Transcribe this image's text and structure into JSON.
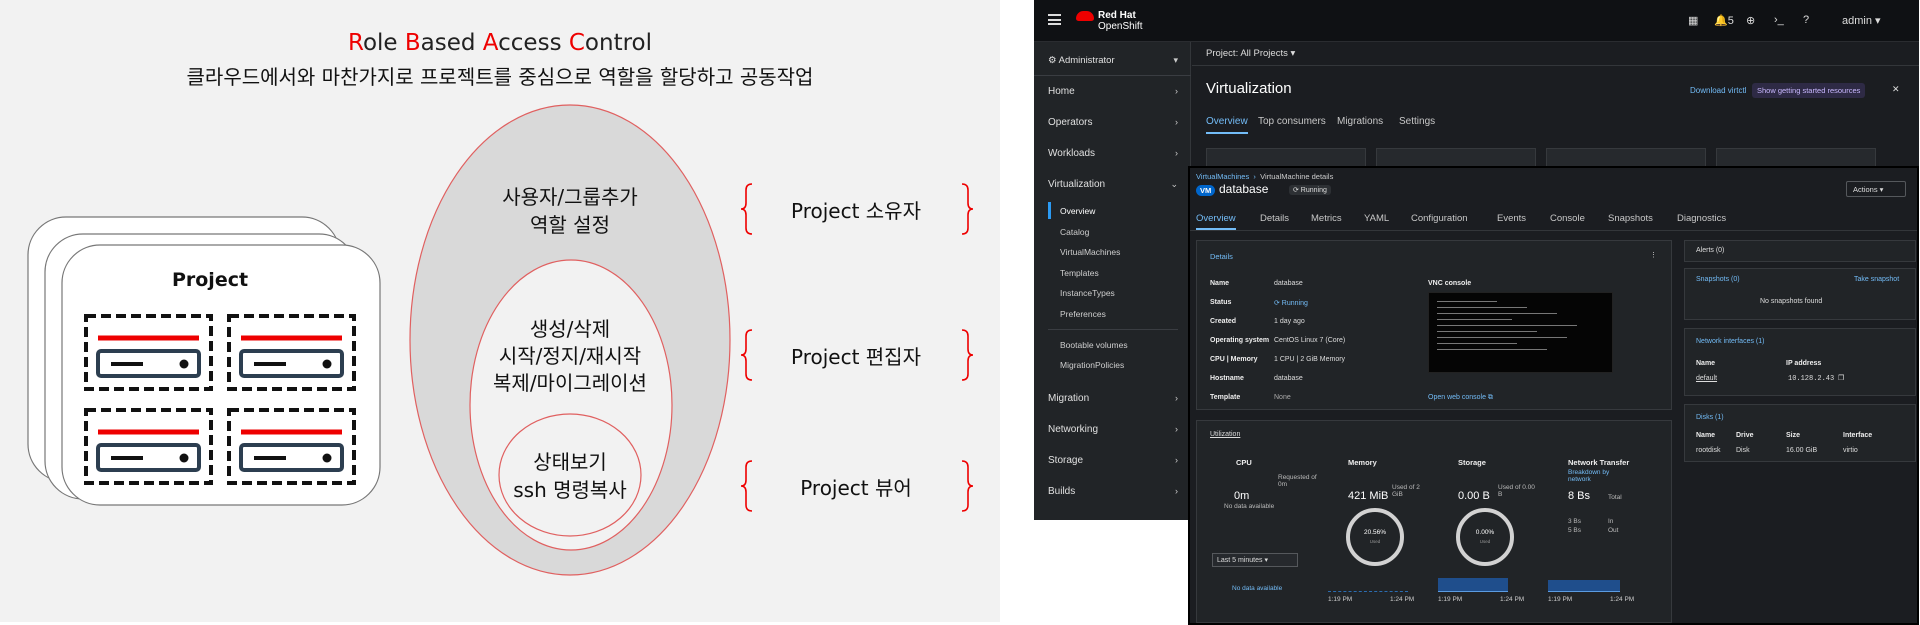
{
  "slide": {
    "title_parts": [
      {
        "cap": "R",
        "rest": "ole "
      },
      {
        "cap": "B",
        "rest": "ased "
      },
      {
        "cap": "A",
        "rest": "ccess "
      },
      {
        "cap": "C",
        "rest": "ontrol"
      }
    ],
    "subtitle": "클라우드에서와 마찬가지로 프로젝트를 중심으로 역할을 할당하고 공동작업",
    "project_label": "Project",
    "owner_perm_line1": "사용자/그룹추가",
    "owner_perm_line2": "역할 설정",
    "editor_perm_line1": "생성/삭제",
    "editor_perm_line2": "시작/정지/재시작",
    "editor_perm_line3": "복제/마이그레이션",
    "viewer_perm_line1": "상태보기",
    "viewer_perm_line2": "ssh 명령복사",
    "role_owner": "Project 소유자",
    "role_editor": "Project 편집자",
    "role_viewer": "Project 뷰어",
    "accent_red": "#e00000"
  },
  "openshift": {
    "brand_line1": "Red Hat",
    "brand_line2": "OpenShift",
    "notif_count": "5",
    "user": "admin ▾",
    "perspective": "Administrator",
    "nav": {
      "home": "Home",
      "operators": "Operators",
      "workloads": "Workloads",
      "virtualization": "Virtualization",
      "sub": [
        "Overview",
        "Catalog",
        "VirtualMachines",
        "Templates",
        "InstanceTypes",
        "Preferences",
        "Bootable volumes",
        "MigrationPolicies"
      ],
      "migration": "Migration",
      "networking": "Networking",
      "storage": "Storage",
      "builds": "Builds"
    },
    "project_selector": "Project: All Projects ▾",
    "page_title": "Virtualization",
    "download_link": "Download virtctl",
    "getting_started": "Show getting started resources",
    "tabs": [
      "Overview",
      "Top consumers",
      "Migrations",
      "Settings"
    ]
  },
  "vm": {
    "breadcrumb_link": "VirtualMachines",
    "breadcrumb_current": "VirtualMachine details",
    "badge": "VM",
    "name": "database",
    "status_pill": "⟳ Running",
    "actions": "Actions ▾",
    "tabs": [
      "Overview",
      "Details",
      "Metrics",
      "YAML",
      "Configuration",
      "Events",
      "Console",
      "Snapshots",
      "Diagnostics"
    ],
    "details_title": "Details",
    "labels": [
      "Name",
      "Status",
      "Created",
      "Operating system",
      "CPU | Memory",
      "Hostname",
      "Template"
    ],
    "values": [
      "database",
      "⟳ Running",
      "1 day ago",
      "CentOS Linux 7 (Core)",
      "1 CPU | 2 GiB Memory",
      "database",
      "None"
    ],
    "vnc_title": "VNC console",
    "open_console": "Open web console ⧉",
    "utilization": "Utilization",
    "cpu": {
      "title": "CPU",
      "value": "0m",
      "requested": "Requested of 0m",
      "note": "No data available"
    },
    "memory": {
      "title": "Memory",
      "value": "421 MiB",
      "used": "Used of 2 GiB",
      "donut_value": "20.56%",
      "donut_unit": "Used"
    },
    "storage": {
      "title": "Storage",
      "value": "0.00 B",
      "used": "Used of 0.00 B",
      "donut_value": "0.00%",
      "donut_unit": "Used"
    },
    "network": {
      "title": "Network Transfer",
      "link": "Breakdown by network",
      "total": "8 Bs",
      "total_label": "Total",
      "in": "3 Bs",
      "in_label": "In",
      "out": "5 Bs",
      "out_label": "Out"
    },
    "time_range": "Last 5 minutes ▾",
    "no_data": "No data available",
    "ticks": [
      "1:19 PM",
      "1:24 PM",
      "1:19 PM",
      "1:24 PM",
      "1:19 PM",
      "1:24 PM"
    ],
    "alerts": "Alerts (0)",
    "snapshots": "Snapshots (0)",
    "take_snapshot": "Take snapshot",
    "no_snapshots": "No snapshots found",
    "net_ifaces": "Network interfaces (1)",
    "net_cols": [
      "Name",
      "IP address"
    ],
    "net_row": [
      "default",
      "10.128.2.43"
    ],
    "disks": "Disks (1)",
    "disk_cols": [
      "Name",
      "Drive",
      "Size",
      "Interface"
    ],
    "disk_row": [
      "rootdisk",
      "Disk",
      "16.00 GiB",
      "virtio"
    ]
  }
}
